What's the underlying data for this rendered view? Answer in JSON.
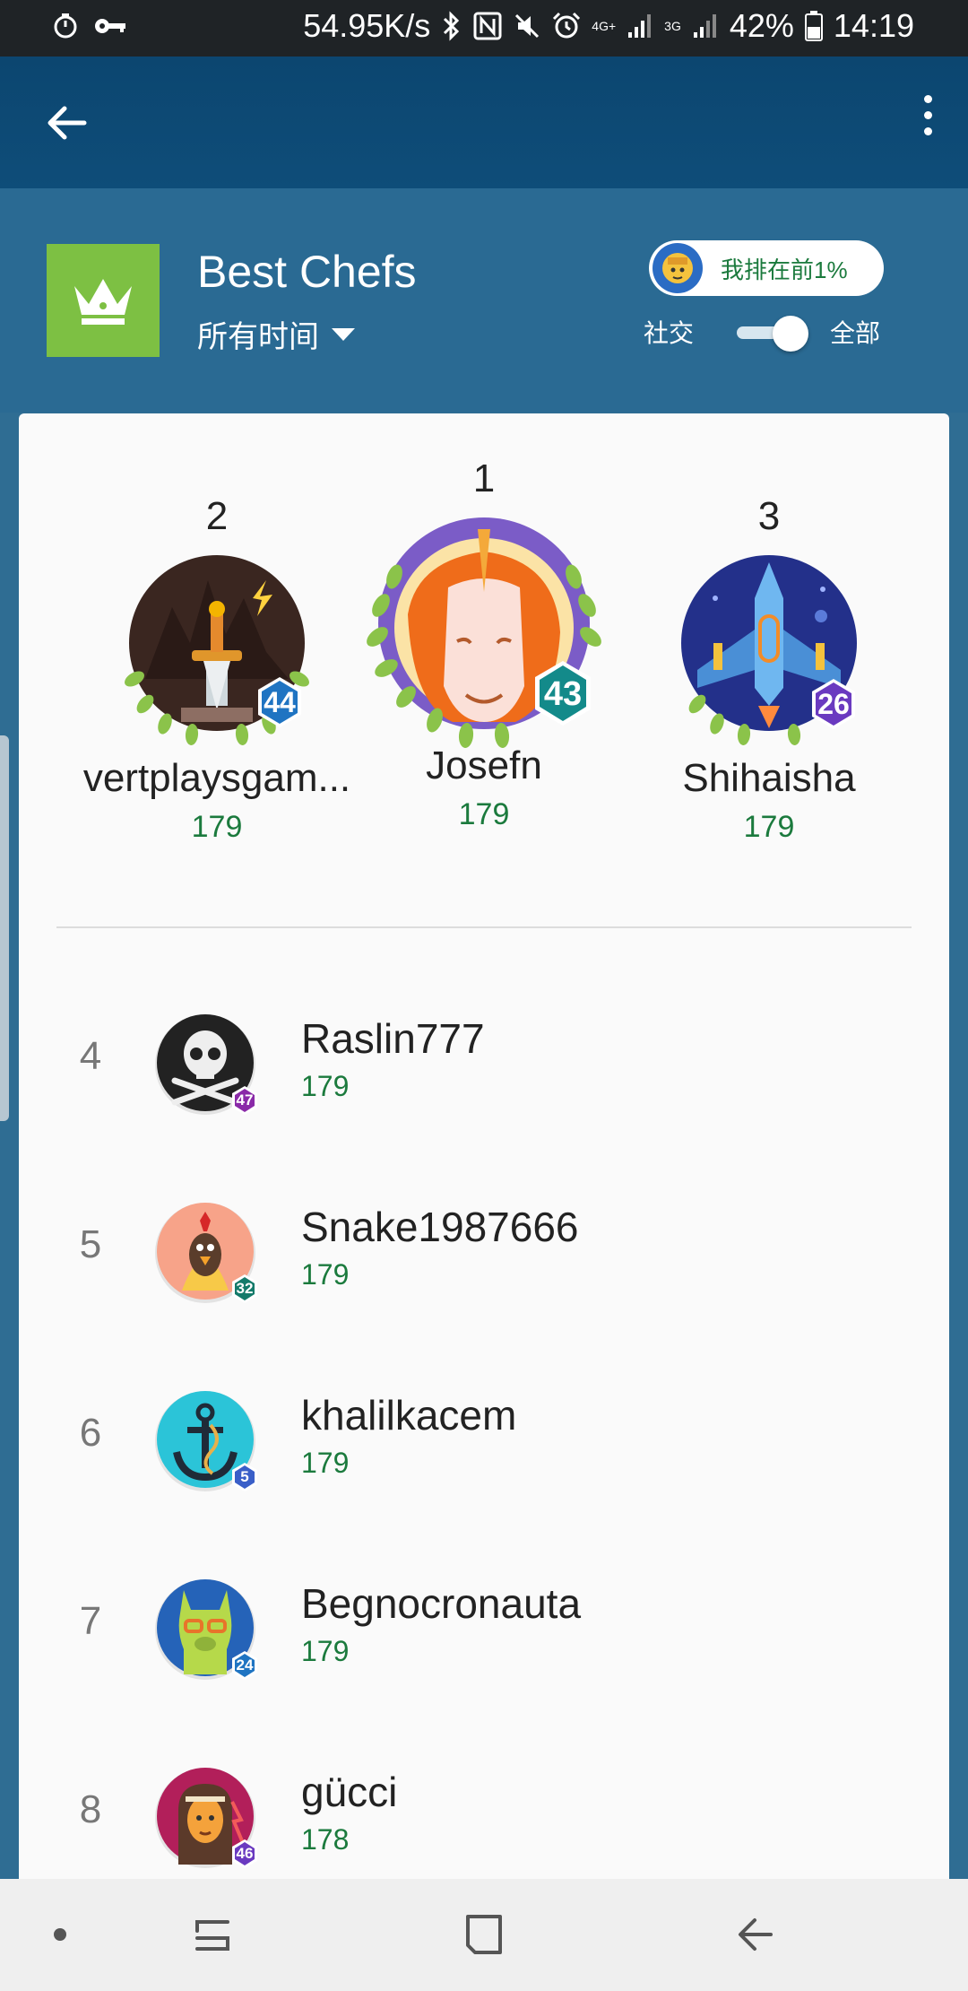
{
  "status_bar": {
    "net_speed": "54.95K/s",
    "network_4g": "4G+",
    "network_3g": "3G",
    "battery": "42%",
    "time": "14:19"
  },
  "app_bar": {
    "back_icon": "arrow-left-icon",
    "menu_icon": "more-vert-icon"
  },
  "header": {
    "title": "Best Chefs",
    "period": "所有时间",
    "my_rank": "我排在前1%",
    "scope_social": "社交",
    "scope_all": "全部",
    "toggle_on": true
  },
  "podium": [
    {
      "rank": "2",
      "name": "vertplaysgam...",
      "score": "179",
      "level": "44",
      "badge_color": "#1f74c2"
    },
    {
      "rank": "1",
      "name": "Josefn",
      "score": "179",
      "level": "43",
      "badge_color": "#138a8a"
    },
    {
      "rank": "3",
      "name": "Shihaisha",
      "score": "179",
      "level": "26",
      "badge_color": "#6a3ac0"
    }
  ],
  "list": [
    {
      "rank": "4",
      "name": "Raslin777",
      "score": "179",
      "level": "47",
      "badge_color": "#8a2aa8"
    },
    {
      "rank": "5",
      "name": "Snake1987666",
      "score": "179",
      "level": "32",
      "badge_color": "#147a6a"
    },
    {
      "rank": "6",
      "name": "khalilkacem",
      "score": "179",
      "level": "5",
      "badge_color": "#3a5fc8"
    },
    {
      "rank": "7",
      "name": "Begnocronauta",
      "score": "179",
      "level": "24",
      "badge_color": "#1f74c2"
    },
    {
      "rank": "8",
      "name": "gücci",
      "score": "178",
      "level": "46",
      "badge_color": "#6a3ac0"
    }
  ],
  "nav_bar": {
    "recents_icon": "recents-icon",
    "home_icon": "home-icon",
    "back_icon": "back-icon"
  }
}
